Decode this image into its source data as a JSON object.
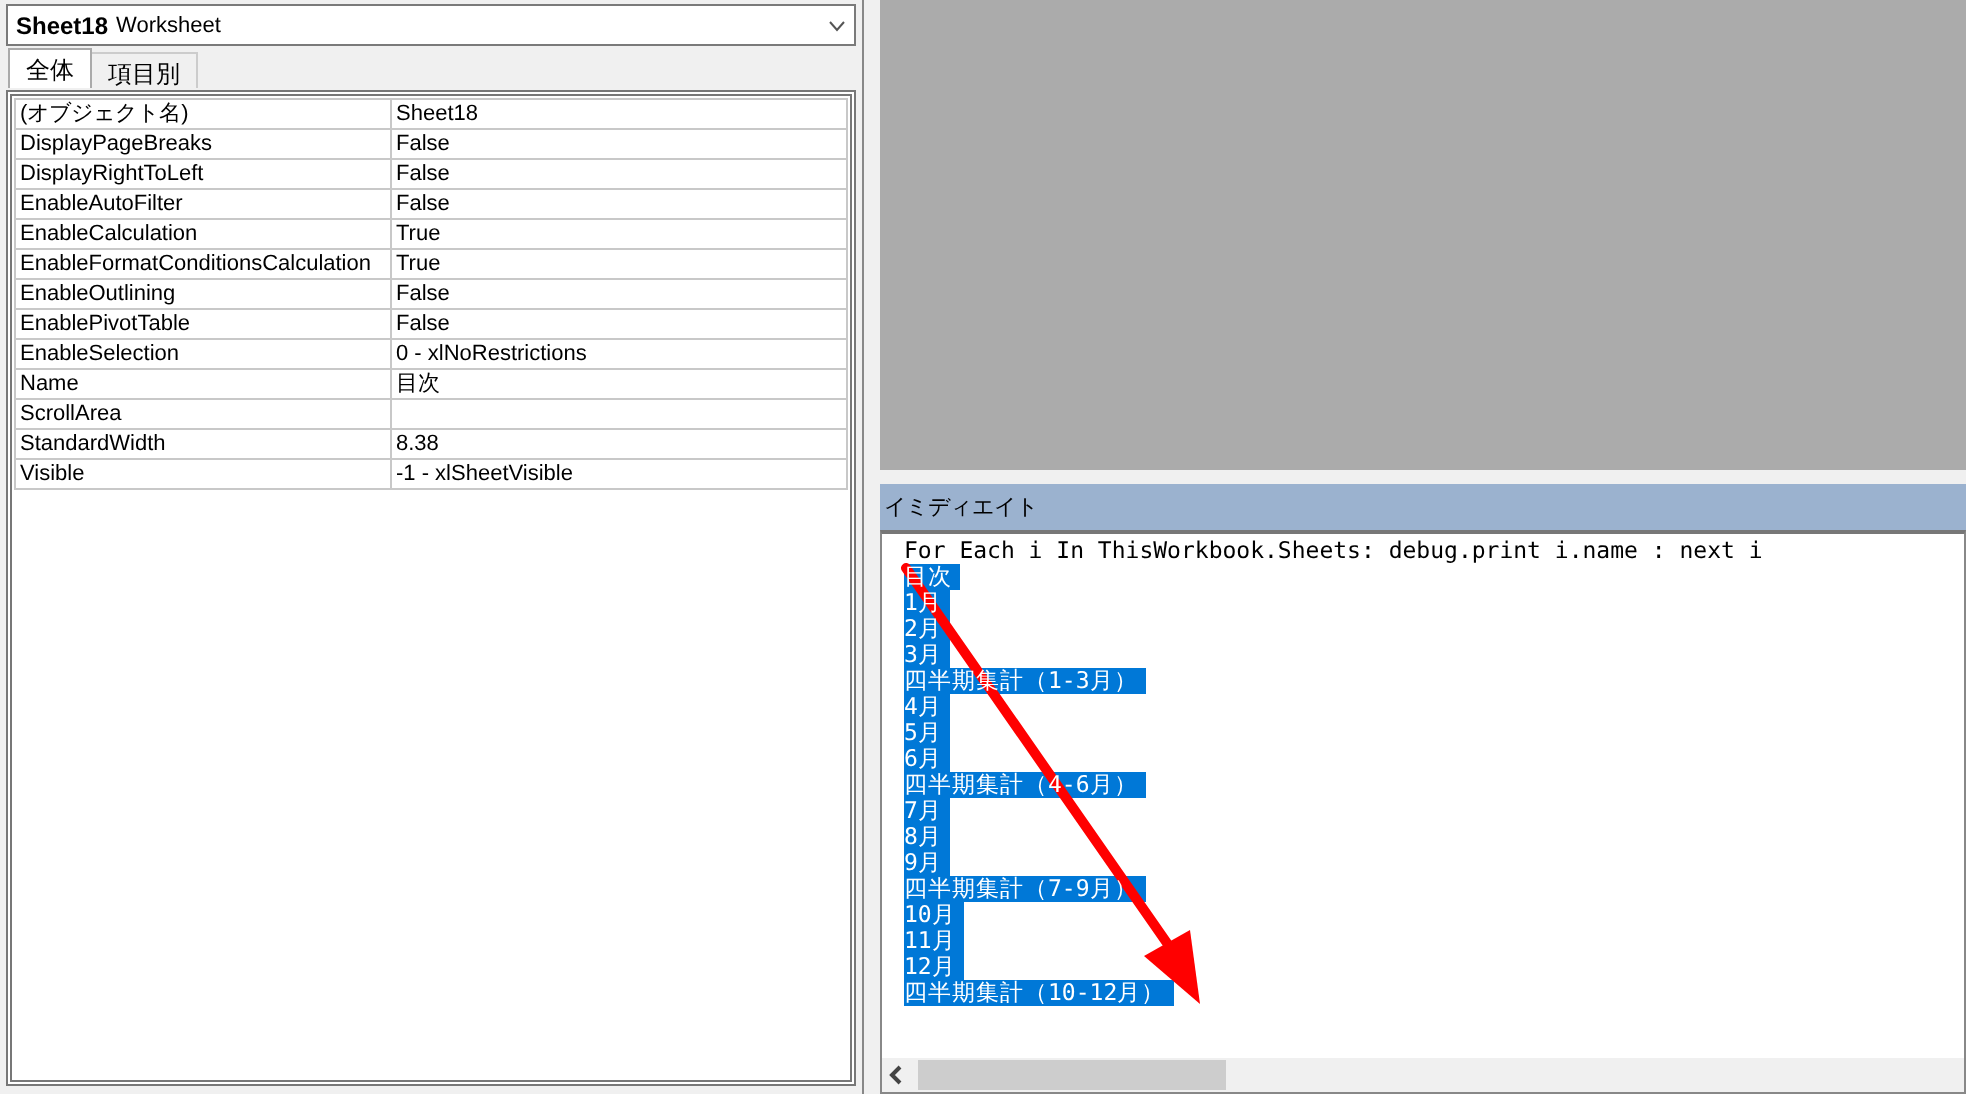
{
  "properties_window": {
    "object_name": "Sheet18",
    "object_type": "Worksheet",
    "tabs": [
      {
        "label": "全体",
        "selected": true
      },
      {
        "label": "項目別",
        "selected": false
      }
    ],
    "properties": [
      {
        "name": "(オブジェクト名)",
        "value": "Sheet18"
      },
      {
        "name": "DisplayPageBreaks",
        "value": "False"
      },
      {
        "name": "DisplayRightToLeft",
        "value": "False"
      },
      {
        "name": "EnableAutoFilter",
        "value": "False"
      },
      {
        "name": "EnableCalculation",
        "value": "True"
      },
      {
        "name": "EnableFormatConditionsCalculation",
        "value": "True"
      },
      {
        "name": "EnableOutlining",
        "value": "False"
      },
      {
        "name": "EnablePivotTable",
        "value": "False"
      },
      {
        "name": "EnableSelection",
        "value": "0 - xlNoRestrictions"
      },
      {
        "name": "Name",
        "value": "目次"
      },
      {
        "name": "ScrollArea"
      },
      {
        "name": "StandardWidth",
        "value": "8.38"
      },
      {
        "name": "Visible",
        "value": "-1 - xlSheetVisible"
      }
    ]
  },
  "immediate_window": {
    "title": "イミディエイト",
    "command": "For Each i In ThisWorkbook.Sheets: debug.print i.name : next i",
    "output": [
      {
        "text": "目次",
        "selected": true
      },
      {
        "text": "1月",
        "selected": true
      },
      {
        "text": "2月",
        "selected": true
      },
      {
        "text": "3月",
        "selected": true
      },
      {
        "text": "四半期集計（1-3月）",
        "selected": true
      },
      {
        "text": "4月",
        "selected": true
      },
      {
        "text": "5月",
        "selected": true
      },
      {
        "text": "6月",
        "selected": true
      },
      {
        "text": "四半期集計（4-6月）",
        "selected": true
      },
      {
        "text": "7月",
        "selected": true
      },
      {
        "text": "8月",
        "selected": true
      },
      {
        "text": "9月",
        "selected": true
      },
      {
        "text": "四半期集計（7-9月）",
        "selected": true
      },
      {
        "text": "10月",
        "selected": true
      },
      {
        "text": "11月",
        "selected": true
      },
      {
        "text": "12月",
        "selected": true
      },
      {
        "text": "四半期集計（10-12月）",
        "selected": true
      }
    ]
  }
}
